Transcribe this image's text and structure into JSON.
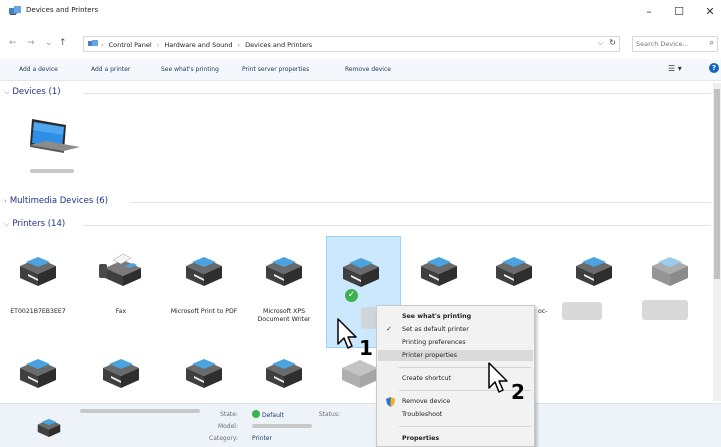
{
  "window": {
    "title": "Devices and Printers",
    "minimize_label": "–",
    "maximize_label": "☐",
    "close_label": "✕"
  },
  "address": {
    "back": "←",
    "forward": "→",
    "up": "↑",
    "breadcrumbs": [
      "Control Panel",
      "Hardware and Sound",
      "Devices and Printers"
    ],
    "dropdown": "⌵",
    "refresh": "↻",
    "search_placeholder": "Search Device...",
    "search_icon": "⌕"
  },
  "toolbar": {
    "add_device": "Add a device",
    "add_printer": "Add a printer",
    "see_printing": "See what's printing",
    "print_server": "Print server properties",
    "remove_device": "Remove device",
    "view": "☰ ▾",
    "help": "?"
  },
  "groups": {
    "devices": "Devices (1)",
    "multimedia": "Multimedia Devices (6)",
    "printers": "Printers (14)"
  },
  "printers_row1": [
    {
      "label": "ET0021B7EB3EE7"
    },
    {
      "label": "Fax"
    },
    {
      "label": "Microsoft Print to PDF"
    },
    {
      "label": "Microsoft XPS Document Writer"
    },
    {
      "label": ""
    },
    {
      "label": ""
    },
    {
      "label": "oc-"
    }
  ],
  "details": {
    "state_label": "State:",
    "state_value": "Default",
    "status_label": "Status:",
    "model_label": "Model:",
    "category_label": "Category:",
    "category_value": "Printer"
  },
  "context_menu": {
    "items": [
      {
        "label": "See what's printing",
        "bold": true
      },
      {
        "label": "Set as default printer",
        "icon": "✓"
      },
      {
        "label": "Printing preferences"
      },
      {
        "label": "Printer properties",
        "hover": true
      },
      {
        "label": "Create shortcut"
      },
      {
        "label": "Remove device",
        "icon": "shield"
      },
      {
        "label": "Troubleshoot"
      },
      {
        "label": "Properties",
        "bold": true
      }
    ]
  },
  "annotations": {
    "step1": "1",
    "step2": "2"
  },
  "colors": {
    "accent": "#1e3287",
    "selection": "#cce8ff",
    "success": "#3bb24f"
  }
}
